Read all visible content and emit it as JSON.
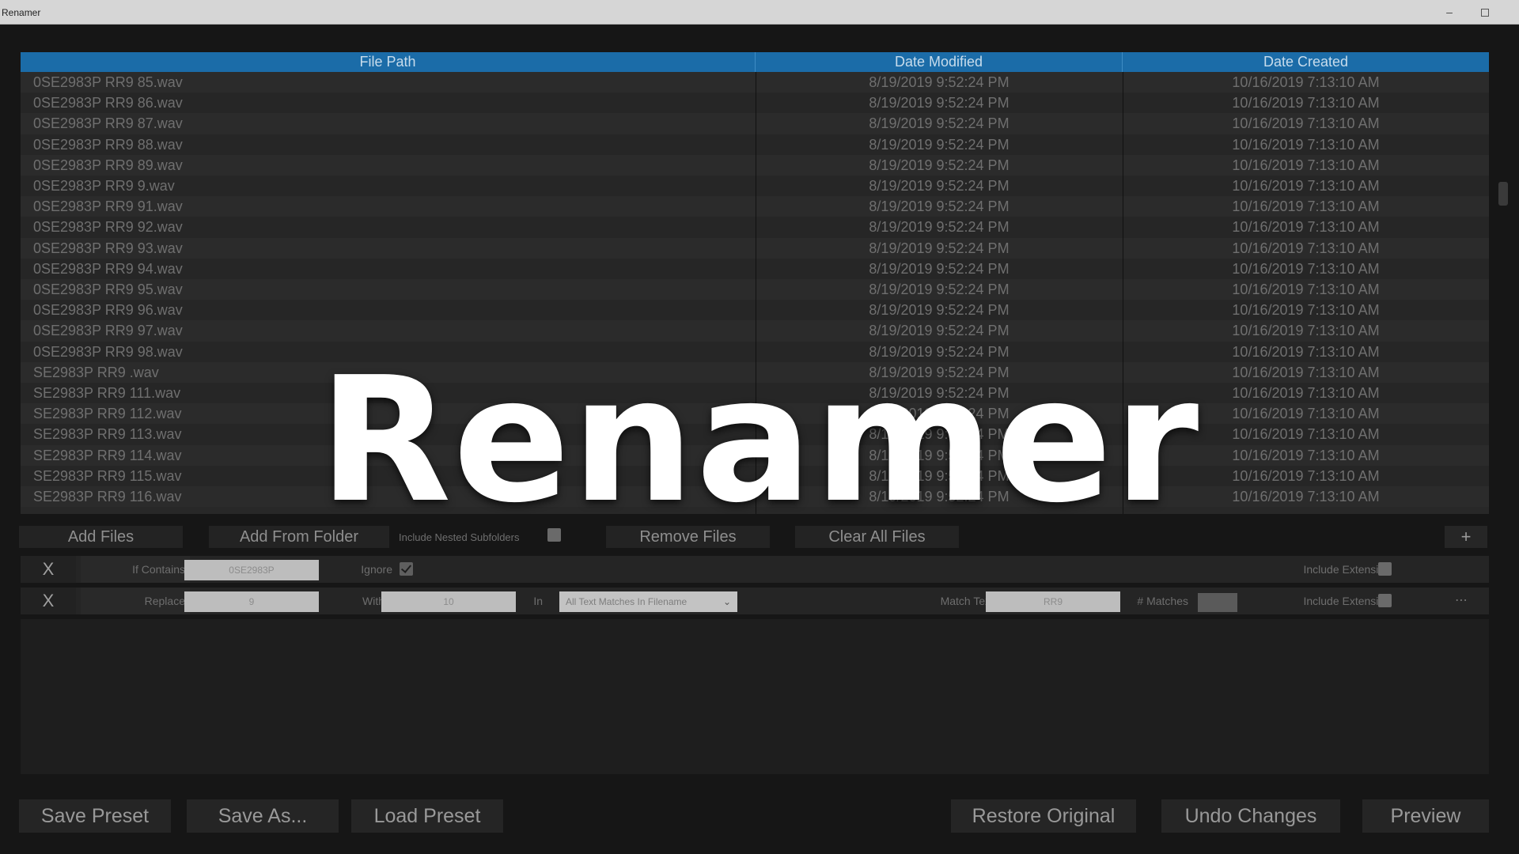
{
  "window": {
    "title": "Renamer",
    "minimize_glyph": "–"
  },
  "table": {
    "headers": {
      "file_path": "File Path",
      "date_modified": "Date Modified",
      "date_created": "Date Created"
    },
    "rows": [
      {
        "path": "0SE2983P RR9 85.wav",
        "modified": "8/19/2019 9:52:24 PM",
        "created": "10/16/2019 7:13:10 AM"
      },
      {
        "path": "0SE2983P RR9 86.wav",
        "modified": "8/19/2019 9:52:24 PM",
        "created": "10/16/2019 7:13:10 AM"
      },
      {
        "path": "0SE2983P RR9 87.wav",
        "modified": "8/19/2019 9:52:24 PM",
        "created": "10/16/2019 7:13:10 AM"
      },
      {
        "path": "0SE2983P RR9 88.wav",
        "modified": "8/19/2019 9:52:24 PM",
        "created": "10/16/2019 7:13:10 AM"
      },
      {
        "path": "0SE2983P RR9 89.wav",
        "modified": "8/19/2019 9:52:24 PM",
        "created": "10/16/2019 7:13:10 AM"
      },
      {
        "path": "0SE2983P RR9 9.wav",
        "modified": "8/19/2019 9:52:24 PM",
        "created": "10/16/2019 7:13:10 AM"
      },
      {
        "path": "0SE2983P RR9 91.wav",
        "modified": "8/19/2019 9:52:24 PM",
        "created": "10/16/2019 7:13:10 AM"
      },
      {
        "path": "0SE2983P RR9 92.wav",
        "modified": "8/19/2019 9:52:24 PM",
        "created": "10/16/2019 7:13:10 AM"
      },
      {
        "path": "0SE2983P RR9 93.wav",
        "modified": "8/19/2019 9:52:24 PM",
        "created": "10/16/2019 7:13:10 AM"
      },
      {
        "path": "0SE2983P RR9 94.wav",
        "modified": "8/19/2019 9:52:24 PM",
        "created": "10/16/2019 7:13:10 AM"
      },
      {
        "path": "0SE2983P RR9 95.wav",
        "modified": "8/19/2019 9:52:24 PM",
        "created": "10/16/2019 7:13:10 AM"
      },
      {
        "path": "0SE2983P RR9 96.wav",
        "modified": "8/19/2019 9:52:24 PM",
        "created": "10/16/2019 7:13:10 AM"
      },
      {
        "path": "0SE2983P RR9 97.wav",
        "modified": "8/19/2019 9:52:24 PM",
        "created": "10/16/2019 7:13:10 AM"
      },
      {
        "path": "0SE2983P RR9 98.wav",
        "modified": "8/19/2019 9:52:24 PM",
        "created": "10/16/2019 7:13:10 AM"
      },
      {
        "path": "SE2983P RR9 .wav",
        "modified": "8/19/2019 9:52:24 PM",
        "created": "10/16/2019 7:13:10 AM"
      },
      {
        "path": "SE2983P RR9 111.wav",
        "modified": "8/19/2019 9:52:24 PM",
        "created": "10/16/2019 7:13:10 AM"
      },
      {
        "path": "SE2983P RR9 112.wav",
        "modified": "8/19/2019 9:52:24 PM",
        "created": "10/16/2019 7:13:10 AM"
      },
      {
        "path": "SE2983P RR9 113.wav",
        "modified": "8/19/2019 9:52:24 PM",
        "created": "10/16/2019 7:13:10 AM"
      },
      {
        "path": "SE2983P RR9 114.wav",
        "modified": "8/19/2019 9:52:24 PM",
        "created": "10/16/2019 7:13:10 AM"
      },
      {
        "path": "SE2983P RR9 115.wav",
        "modified": "8/19/2019 9:52:24 PM",
        "created": "10/16/2019 7:13:10 AM"
      },
      {
        "path": "SE2983P RR9 116.wav",
        "modified": "8/19/2019 9:52:24 PM",
        "created": "10/16/2019 7:13:10 AM"
      }
    ]
  },
  "toolbar": {
    "add_files": "Add Files",
    "add_from_folder": "Add From Folder",
    "include_nested": "Include Nested Subfolders",
    "remove_files": "Remove Files",
    "clear_all": "Clear All Files",
    "add_rule": "+"
  },
  "rules": {
    "rule1": {
      "remove": "X",
      "type": "If Contains",
      "value": "0SE2983P",
      "ignore_label": "Ignore",
      "include_ext_label": "Include Extension"
    },
    "rule2": {
      "remove": "X",
      "type": "Replace",
      "value": "9",
      "with_label": "With",
      "with_value": "10",
      "in_label": "In",
      "scope": "All Text Matches In Filename",
      "match_text_label": "Match Text",
      "match_text_value": "RR9",
      "matches_label": "# Matches",
      "include_ext_label": "Include Extension",
      "more": "⋯"
    }
  },
  "bottom": {
    "save_preset": "Save Preset",
    "save_as": "Save As...",
    "load_preset": "Load Preset",
    "restore_original": "Restore Original",
    "undo_changes": "Undo Changes",
    "preview": "Preview"
  },
  "overlay": {
    "title": "Renamer"
  },
  "colors": {
    "header_blue": "#1b6ca8",
    "background": "#161616",
    "overlay_text": "#ffffff"
  },
  "icons": {
    "minimize": "minimize-icon",
    "maximize": "maximize-icon",
    "checkmark": "checkmark-icon",
    "chevron": "chevron-down-icon"
  }
}
